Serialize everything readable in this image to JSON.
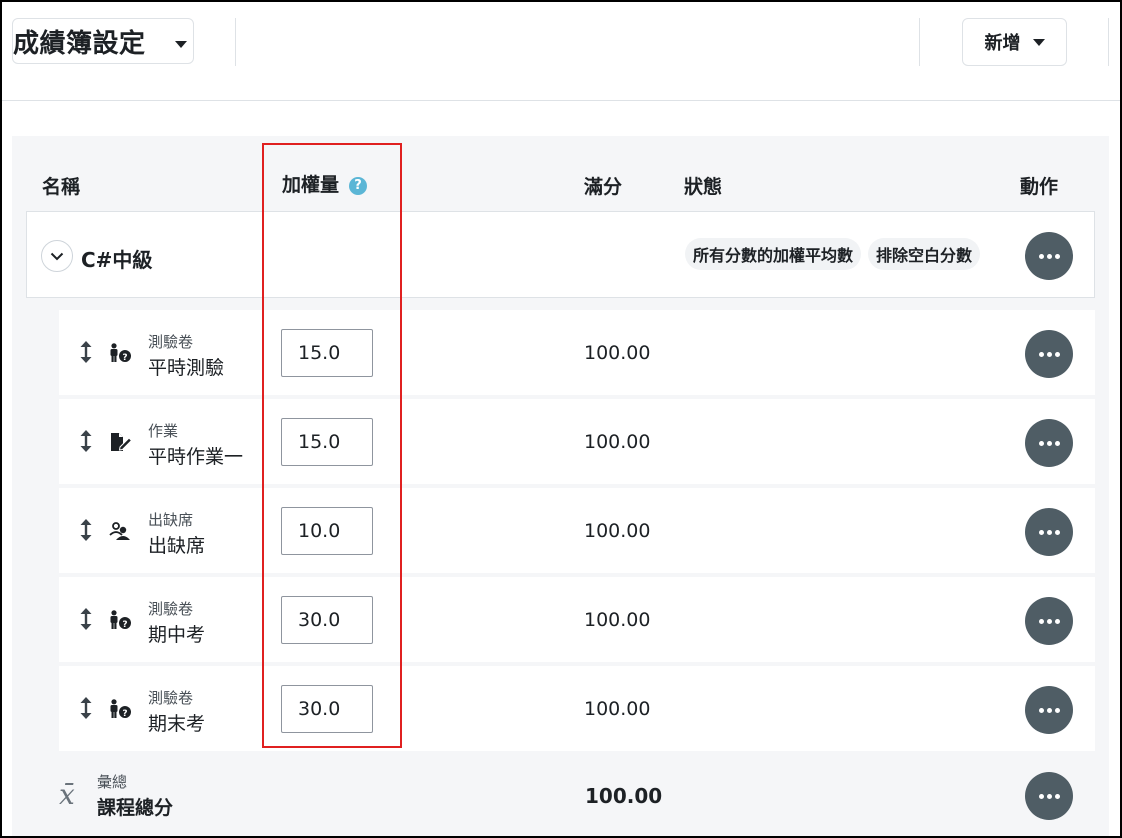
{
  "header": {
    "title": "成績簿設定",
    "add_label": "新增"
  },
  "columns": {
    "name": "名稱",
    "weight": "加權量",
    "weight_help": "?",
    "max": "滿分",
    "status": "狀態",
    "actions": "動作"
  },
  "category": {
    "name": "C#中級",
    "badges": [
      "所有分數的加權平均數",
      "排除空白分數"
    ]
  },
  "items": [
    {
      "type": "測驗卷",
      "name": "平時測驗",
      "weight": "15.0",
      "max": "100.00",
      "icon": "quiz-icon"
    },
    {
      "type": "作業",
      "name": "平時作業一",
      "weight": "15.0",
      "max": "100.00",
      "icon": "assignment-icon"
    },
    {
      "type": "出缺席",
      "name": "出缺席",
      "weight": "10.0",
      "max": "100.00",
      "icon": "attendance-icon"
    },
    {
      "type": "測驗卷",
      "name": "期中考",
      "weight": "30.0",
      "max": "100.00",
      "icon": "quiz-icon"
    },
    {
      "type": "測驗卷",
      "name": "期末考",
      "weight": "30.0",
      "max": "100.00",
      "icon": "quiz-icon"
    }
  ],
  "total": {
    "symbol": "x̄",
    "type": "彙總",
    "name": "課程總分",
    "max": "100.00"
  },
  "colors": {
    "action_button": "#4f5d65",
    "highlight": "#e02020",
    "help_icon": "#5bb6d6"
  }
}
